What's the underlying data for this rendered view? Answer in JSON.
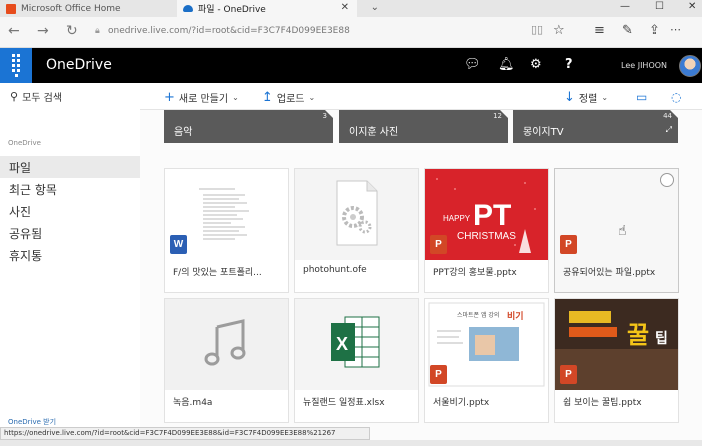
{
  "browser": {
    "tabs": [
      {
        "title": "Microsoft Office Home",
        "active": false
      },
      {
        "title": "파일 - OneDrive",
        "active": true
      }
    ],
    "url": "onedrive.live.com/?id=root&cid=F3C7F4D099EE3E88",
    "status_url": "https://onedrive.live.com/?id=root&cid=F3C7F4D099EE3E88&id=F3C7F4D099EE3E88%21267"
  },
  "header": {
    "brand": "OneDrive",
    "user_name": "Lee JIHOON"
  },
  "leftnav": {
    "search_placeholder": "모두 검색",
    "section_label": "OneDrive",
    "items": [
      {
        "label": "파일",
        "active": true
      },
      {
        "label": "최근 항목",
        "active": false
      },
      {
        "label": "사진",
        "active": false
      },
      {
        "label": "공유됨",
        "active": false
      },
      {
        "label": "휴지통",
        "active": false
      }
    ],
    "footer": "OneDrive 받기 "
  },
  "commandbar": {
    "new_label": "새로 만들기",
    "upload_label": "업로드",
    "sort_label": "정렬"
  },
  "folders": [
    {
      "name": "음악",
      "count": "3"
    },
    {
      "name": "이지훈 사진",
      "count": "12"
    },
    {
      "name": "몽이지TV",
      "count": "44"
    }
  ],
  "files": [
    {
      "name": "F/의 맛있는 포트폴리...",
      "type": "word"
    },
    {
      "name": "photohunt.ofe",
      "type": "generic"
    },
    {
      "name": "PPT강의 홍보물.pptx",
      "type": "ppt",
      "thumb_text": "HAPPY PT CHRISTMAS"
    },
    {
      "name": "공유되어있는 파일.pptx",
      "type": "ppt",
      "selected": true
    },
    {
      "name": "녹음.m4a",
      "type": "audio"
    },
    {
      "name": "뉴질랜드 일정표.xlsx",
      "type": "excel"
    },
    {
      "name": "서울비기.pptx",
      "type": "ppt"
    },
    {
      "name": "쉽 보이는 꿀팁.pptx",
      "type": "ppt",
      "thumb_text": "꿀팁"
    }
  ]
}
